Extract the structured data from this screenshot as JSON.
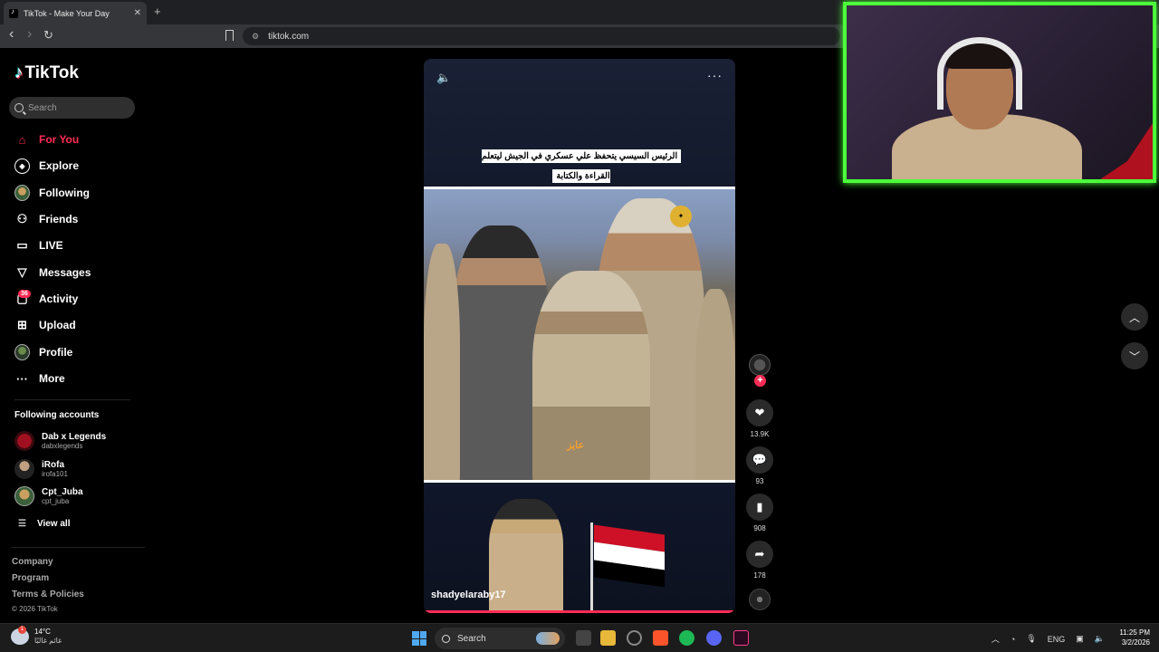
{
  "browser": {
    "tab_title": "TikTok - Make Your Day",
    "tab_close": "✕",
    "new_tab": "+",
    "url": "tiktok.com",
    "back": "‹",
    "forward": "›",
    "reload": "↻"
  },
  "sidebar": {
    "logo": "TikTok",
    "search_placeholder": "Search",
    "nav": [
      {
        "label": "For You",
        "icon": "home-icon",
        "glyph": "⌂"
      },
      {
        "label": "Explore",
        "icon": "compass-icon",
        "glyph": "◎"
      },
      {
        "label": "Following",
        "icon": "following-avatar-icon",
        "glyph": ""
      },
      {
        "label": "Friends",
        "icon": "friends-icon",
        "glyph": "⚇"
      },
      {
        "label": "LIVE",
        "icon": "live-icon",
        "glyph": "▭"
      },
      {
        "label": "Messages",
        "icon": "messages-icon",
        "glyph": "▽"
      },
      {
        "label": "Activity",
        "icon": "activity-icon",
        "glyph": "▢"
      },
      {
        "label": "Upload",
        "icon": "upload-icon",
        "glyph": "⊞"
      },
      {
        "label": "Profile",
        "icon": "profile-avatar-icon",
        "glyph": ""
      },
      {
        "label": "More",
        "icon": "more-icon",
        "glyph": "···"
      }
    ],
    "activity_badge": "36",
    "following_title": "Following accounts",
    "accounts": [
      {
        "name": "Dab x Legends",
        "handle": "dabxlegends"
      },
      {
        "name": "iRofa",
        "handle": "irofa101"
      },
      {
        "name": "Cpt_Juba",
        "handle": "cpt_juba"
      }
    ],
    "view_all": "View all",
    "footer": [
      "Company",
      "Program",
      "Terms & Policies"
    ],
    "copyright": "© 2026 TikTok"
  },
  "video": {
    "caption": "الرئيس السيسي يتحفظ علي عسكري في الجيش ليتعلم القراءة والكتابة",
    "scene_text": "عايز",
    "username": "shadyelaraby17",
    "more": "···"
  },
  "actions": {
    "likes": "13.9K",
    "comments": "93",
    "saves": "908",
    "shares": "178",
    "follow": "+"
  },
  "taskbar": {
    "temperature": "14°C",
    "condition": "غائم غالبًا",
    "search": "Search",
    "language": "ENG",
    "time": "11:25 PM",
    "date": "3/2/2026"
  },
  "colors": {
    "accent": "#fe2c55",
    "webcam_border": "#4cff3a",
    "background": "#000000"
  }
}
